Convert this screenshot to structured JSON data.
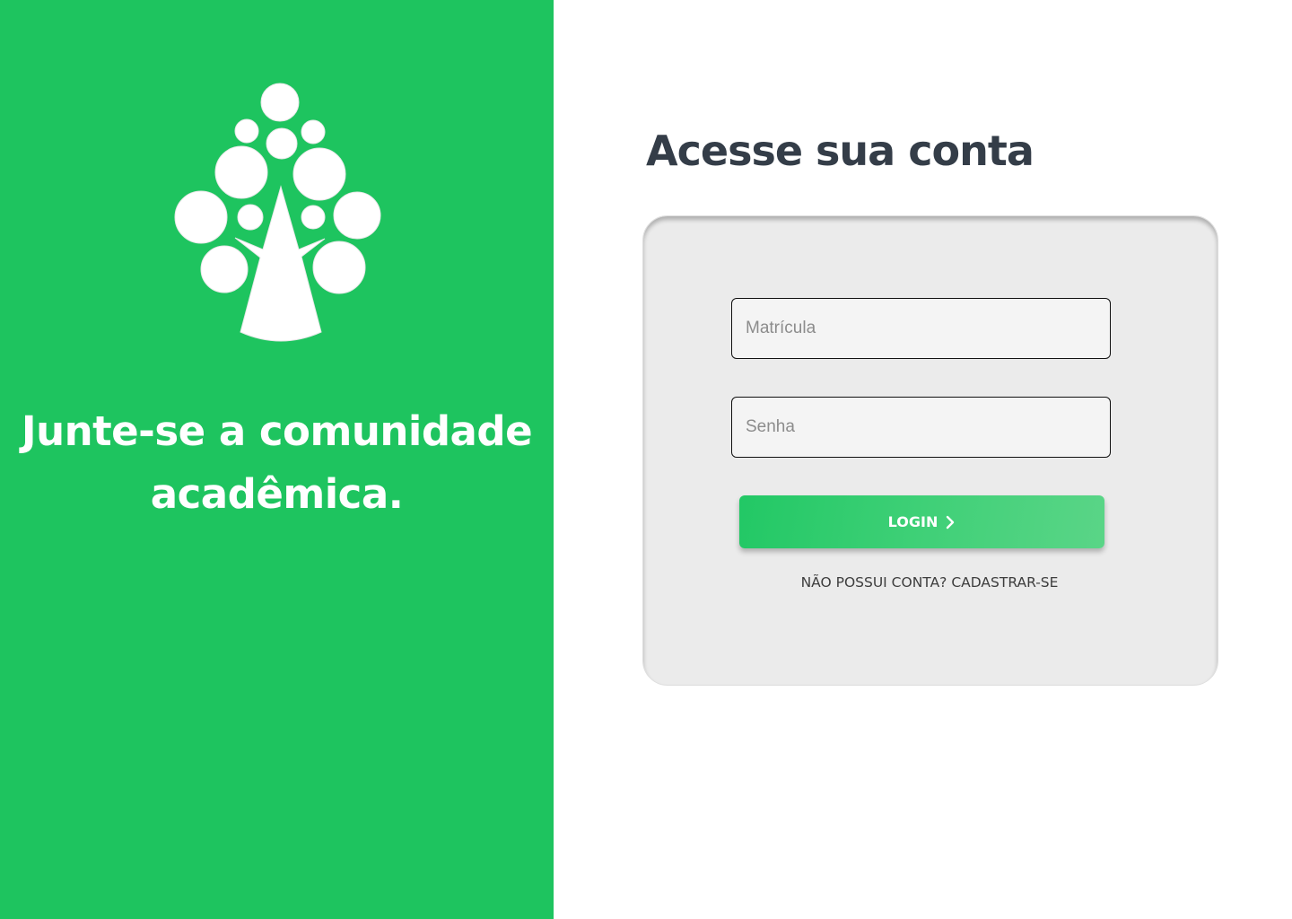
{
  "brand": {
    "logo_icon": "tree-icon",
    "tagline": "Junte-se a comunidade acadêmica.",
    "colors": {
      "primary_green": "#1ec45f",
      "heading_text": "#343d48",
      "card_background": "#ebebeb"
    }
  },
  "login": {
    "heading": "Acesse sua conta",
    "matricula_placeholder": "Matrícula",
    "matricula_value": "",
    "senha_placeholder": "Senha",
    "senha_value": "",
    "login_label": "LOGIN",
    "login_icon": "chevron-right-icon",
    "signup_link": "NÃO POSSUI CONTA? CADASTRAR-SE"
  }
}
